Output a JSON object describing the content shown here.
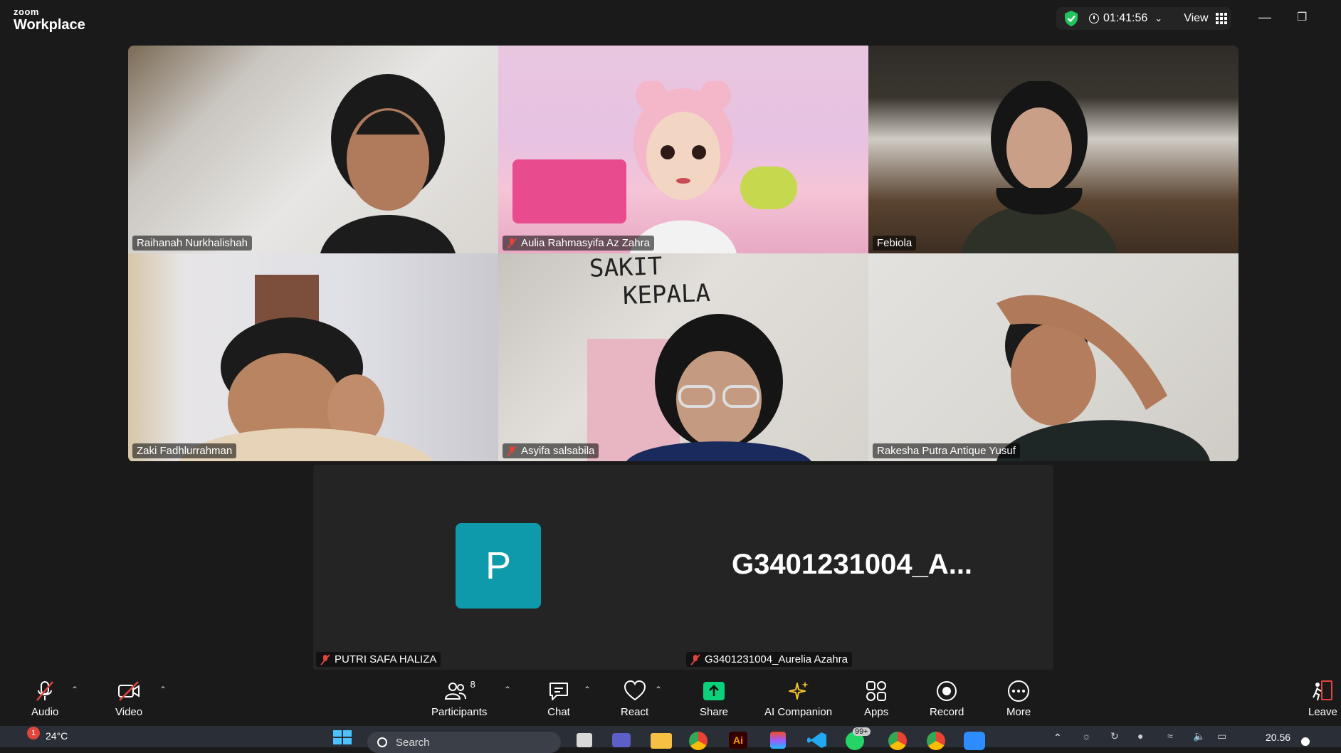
{
  "app": {
    "brand_small": "zoom",
    "brand_large": "Workplace"
  },
  "header": {
    "timer": "01:41:56",
    "view_label": "View"
  },
  "participants": [
    {
      "name": "Raihanah Nurkhalishah",
      "muted": false
    },
    {
      "name": "Aulia Rahmasyifa Az Zahra",
      "muted": true
    },
    {
      "name": "Febiola",
      "muted": false
    },
    {
      "name": "Zaki Fadhlurrahman",
      "muted": false
    },
    {
      "name": "Asyifa salsabila",
      "muted": true,
      "sign_text_1": "SAKIT",
      "sign_text_2": "KEPALA"
    },
    {
      "name": "Rakesha Putra Antique Yusuf",
      "muted": false,
      "active": true
    }
  ],
  "bottom": {
    "avatar_letter": "P",
    "big_name": "G3401231004_A...",
    "left_name": "PUTRI SAFA HALIZA",
    "right_name": "G3401231004_Aurelia Azahra"
  },
  "toolbar": {
    "audio": "Audio",
    "video": "Video",
    "participants": "Participants",
    "participants_count": "8",
    "chat": "Chat",
    "react": "React",
    "share": "Share",
    "ai_companion": "AI Companion",
    "apps": "Apps",
    "record": "Record",
    "more": "More",
    "leave": "Leave"
  },
  "taskbar": {
    "weather": "24°C",
    "weather_badge": "1",
    "search_placeholder": "Search",
    "badge": "99+",
    "clock": "20.56"
  },
  "colors": {
    "share_green": "#0bd17a",
    "active_border": "#2ecc8a",
    "avatar_bg": "#0e9aaa",
    "mute_red": "#e0453c"
  }
}
